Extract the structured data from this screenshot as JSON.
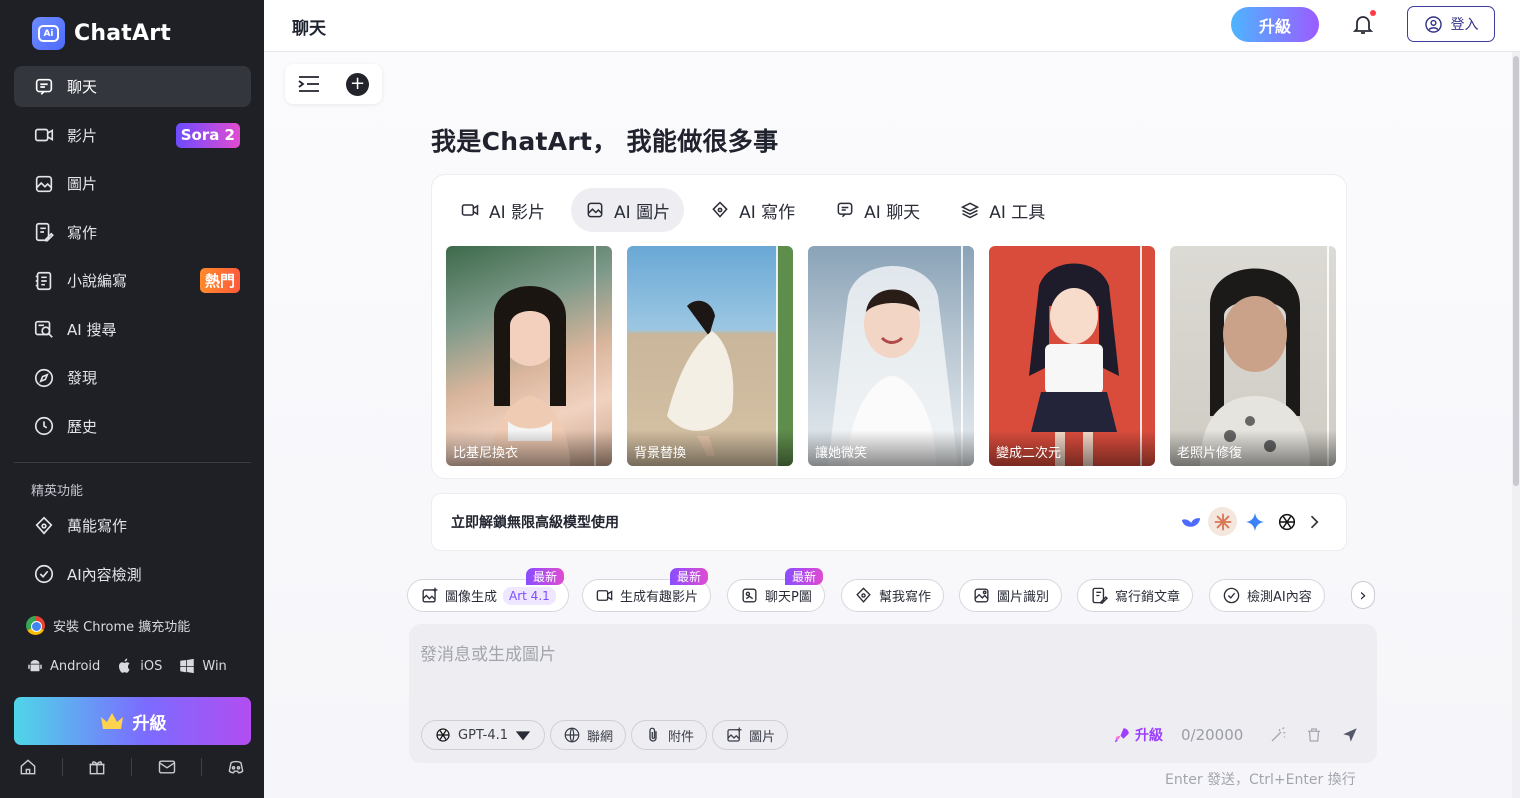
{
  "app": {
    "name": "ChatArt",
    "logo_text": "ChatArt"
  },
  "sidebar": {
    "items": [
      {
        "label": "聊天",
        "icon": "chat-icon",
        "active": true
      },
      {
        "label": "影片",
        "icon": "video-icon",
        "badge": "Sora 2"
      },
      {
        "label": "圖片",
        "icon": "image-icon"
      },
      {
        "label": "寫作",
        "icon": "write-icon"
      },
      {
        "label": "小說編寫",
        "icon": "novel-icon",
        "badge": "熱門"
      },
      {
        "label": "AI 搜尋",
        "icon": "search-icon"
      },
      {
        "label": "發現",
        "icon": "compass-icon"
      },
      {
        "label": "歷史",
        "icon": "history-icon"
      }
    ],
    "section_label": "精英功能",
    "elite_items": [
      {
        "label": "萬能寫作",
        "icon": "pen-icon"
      },
      {
        "label": "AI內容檢測",
        "icon": "check-icon"
      }
    ],
    "chrome_ext": "安裝 Chrome 擴充功能",
    "platforms": {
      "android": "Android",
      "ios": "iOS",
      "win": "Win"
    },
    "upgrade_label": "升級"
  },
  "topbar": {
    "title": "聊天",
    "upgrade_label": "升級",
    "login_label": "登入"
  },
  "hero": {
    "title": "我是ChatArt， 我能做很多事"
  },
  "tabs": [
    {
      "label": "AI 影片",
      "icon": "video-icon"
    },
    {
      "label": "AI 圖片",
      "icon": "image-icon",
      "active": true
    },
    {
      "label": "AI 寫作",
      "icon": "pen-icon"
    },
    {
      "label": "AI 聊天",
      "icon": "chat-icon"
    },
    {
      "label": "AI 工具",
      "icon": "layers-icon"
    }
  ],
  "thumbnails": [
    {
      "caption": "比基尼換衣"
    },
    {
      "caption": "背景替換"
    },
    {
      "caption": "讓她微笑"
    },
    {
      "caption": "變成二次元"
    },
    {
      "caption": "老照片修復"
    }
  ],
  "unlock": {
    "text": "立即解鎖無限高級模型使用"
  },
  "quick_actions": [
    {
      "label": "圖像生成",
      "extra": "Art 4.1",
      "tag": "最新"
    },
    {
      "label": "生成有趣影片",
      "tag": "最新"
    },
    {
      "label": "聊天P圖",
      "tag": "最新"
    },
    {
      "label": "幫我寫作"
    },
    {
      "label": "圖片識別"
    },
    {
      "label": "寫行銷文章"
    },
    {
      "label": "檢測AI內容"
    }
  ],
  "composer": {
    "placeholder": "發消息或生成圖片",
    "model": "GPT-4.1",
    "web_label": "聯網",
    "attach_label": "附件",
    "image_label": "圖片",
    "upgrade_label": "升級",
    "counter": "0/20000"
  },
  "hint": "Enter 發送，Ctrl+Enter 換行",
  "colors": {
    "accent": "#7b6cff",
    "sidebar_bg": "#1f2025",
    "badge_hot": "#ff6a33"
  }
}
